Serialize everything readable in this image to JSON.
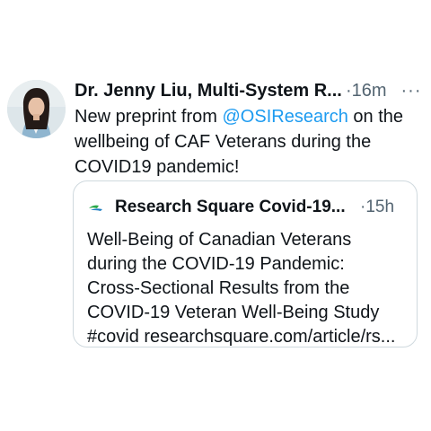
{
  "tweet": {
    "author": "Dr. Jenny Liu, Multi-System R...",
    "time": "·16m",
    "more_icon": "···",
    "text_before": "New preprint from ",
    "mention": "@OSIResearch",
    "text_after_line1": " on the",
    "text_line2": "wellbeing of CAF Veterans during the",
    "text_line3": "COVID19 pandemic!"
  },
  "quote": {
    "author": "Research Square Covid-19...",
    "time": "·15h",
    "lines": [
      "Well-Being of Canadian Veterans",
      "during the COVID-19 Pandemic:",
      "Cross-Sectional Results from the",
      "COVID-19 Veteran Well-Being Study",
      "#covid researchsquare.com/article/rs..."
    ]
  },
  "colors": {
    "link": "#1d9bf0",
    "secondary_text": "#536471",
    "border": "#cfd9de"
  }
}
